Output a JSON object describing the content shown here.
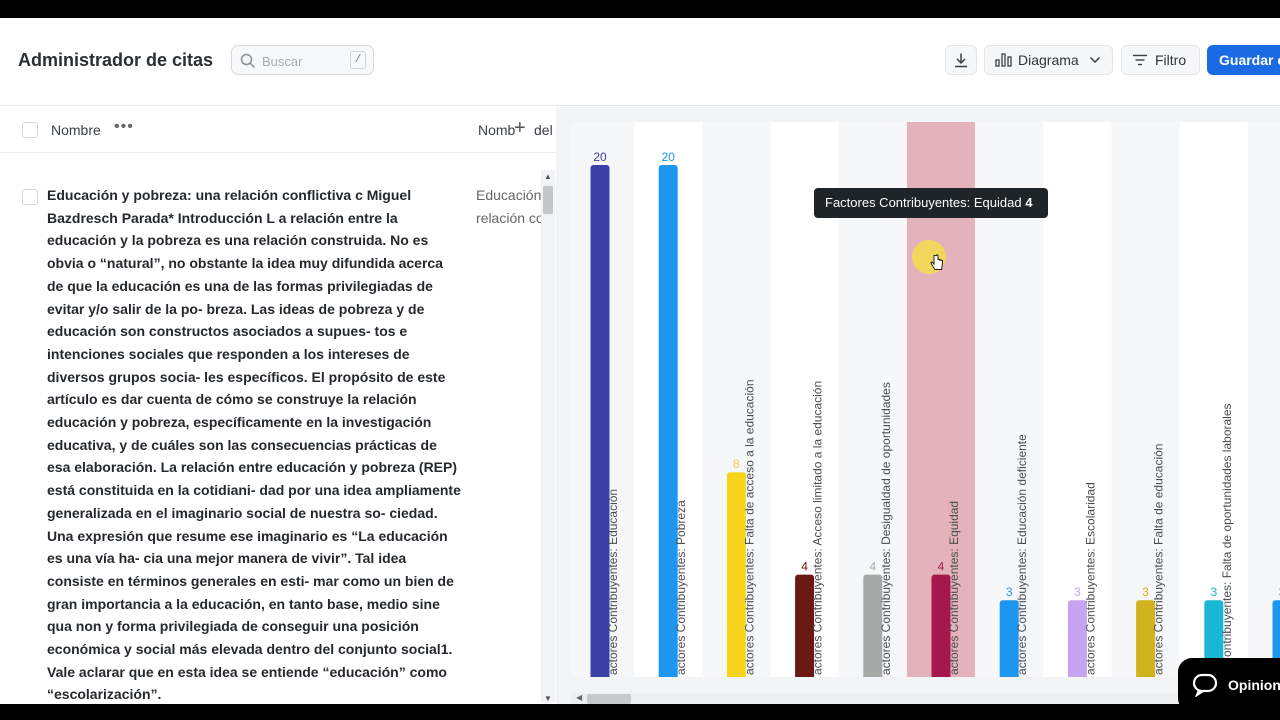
{
  "header": {
    "title": "Administrador de citas",
    "search_placeholder": "Buscar",
    "search_shortcut": "/",
    "chart_button": "Diagrama",
    "filter_button": "Filtro",
    "save_button": "Guardar c"
  },
  "table": {
    "col_name": "Nombre",
    "col_dots": "•••",
    "col_second": "Nombr",
    "col_second_suffix": "del",
    "row": {
      "text": "Educación y pobreza: una relación conflictiva c Miguel Bazdresch Parada* Introducción L a relación entre la educación y la pobreza es una relación construida. No es obvia o “natural”, no obstante la idea muy difundida acerca de que la educación es una de las formas privilegiadas de evitar y/o salir de la po- breza. Las ideas de pobreza y de educación son constructos asociados a supues- tos e intenciones sociales que responden a los intereses de diversos grupos socia- les específicos. El propósito de este artículo es dar cuenta de cómo se construye la relación educación y pobreza, específicamente en la investigación educativa, y de cuáles son las consecuencias prácticas de esa elaboración. La relación entre educación y pobreza (REP) está constituida en la cotidiani- dad por una idea ampliamente generalizada en el imaginario social de nuestra so- ciedad. Una expresión que resume ese imaginario es “La educación es una vía ha- cia una mejor manera de vivir”. Tal idea consiste en términos generales en esti- mar como un bien de gran importancia a la educación, en tanto base, medio sine qua non y forma privilegiada de conseguir una posición económica y social más elevada dentro del conjunto social1. Vale aclarar que en esta idea se entiende “educación” como “escolarización”.",
      "second_col_line1": "Educación",
      "second_col_line2": "relación co"
    }
  },
  "tooltip": {
    "label": "Factores Contribuyentes: Equidad",
    "value": "4"
  },
  "feedback_button": "Opinion",
  "chart_data": {
    "type": "bar",
    "categories": [
      "actores Contribuyentes: Educación",
      "actores Contribuyentes: Pobreza",
      "actores Contribuyentes: Falta de acceso a la educación",
      "actores Contribuyentes: Acceso limitado a la educación",
      "actores Contribuyentes: Desigualdad de oportunidades",
      "actores Contribuyentes: Equidad",
      "actores Contribuyentes: Educación deficiente",
      "actores Contribuyentes: Escolaridad",
      "actores Contribuyentes: Falta de educación",
      "s Contribuyentes: Falta de oportunidades laborales",
      ""
    ],
    "values": [
      20,
      20,
      8,
      4,
      4,
      4,
      3,
      3,
      3,
      3,
      3
    ],
    "colors": [
      "#3b3fa8",
      "#1d96f0",
      "#f7d51d",
      "#6b1a13",
      "#a7a9a6",
      "#a4184c",
      "#1d96f0",
      "#c7a4f2",
      "#d2b21d",
      "#1ab7d4",
      "#1d96f0"
    ],
    "label_colors": [
      "#3b3fa8",
      "#1d96f0",
      "#f0d24a",
      "#6b1a13",
      "#a7a9a6",
      "#a4184c",
      "#1d96f0",
      "#c7a4f2",
      "#d2b21d",
      "#1ab7d4",
      "#1d96f0"
    ],
    "highlighted_index": 5,
    "highlight_color": "#e3b2ba",
    "ylim": [
      0,
      20
    ],
    "grid": false,
    "legend": "none",
    "xlabel": "",
    "ylabel": ""
  }
}
